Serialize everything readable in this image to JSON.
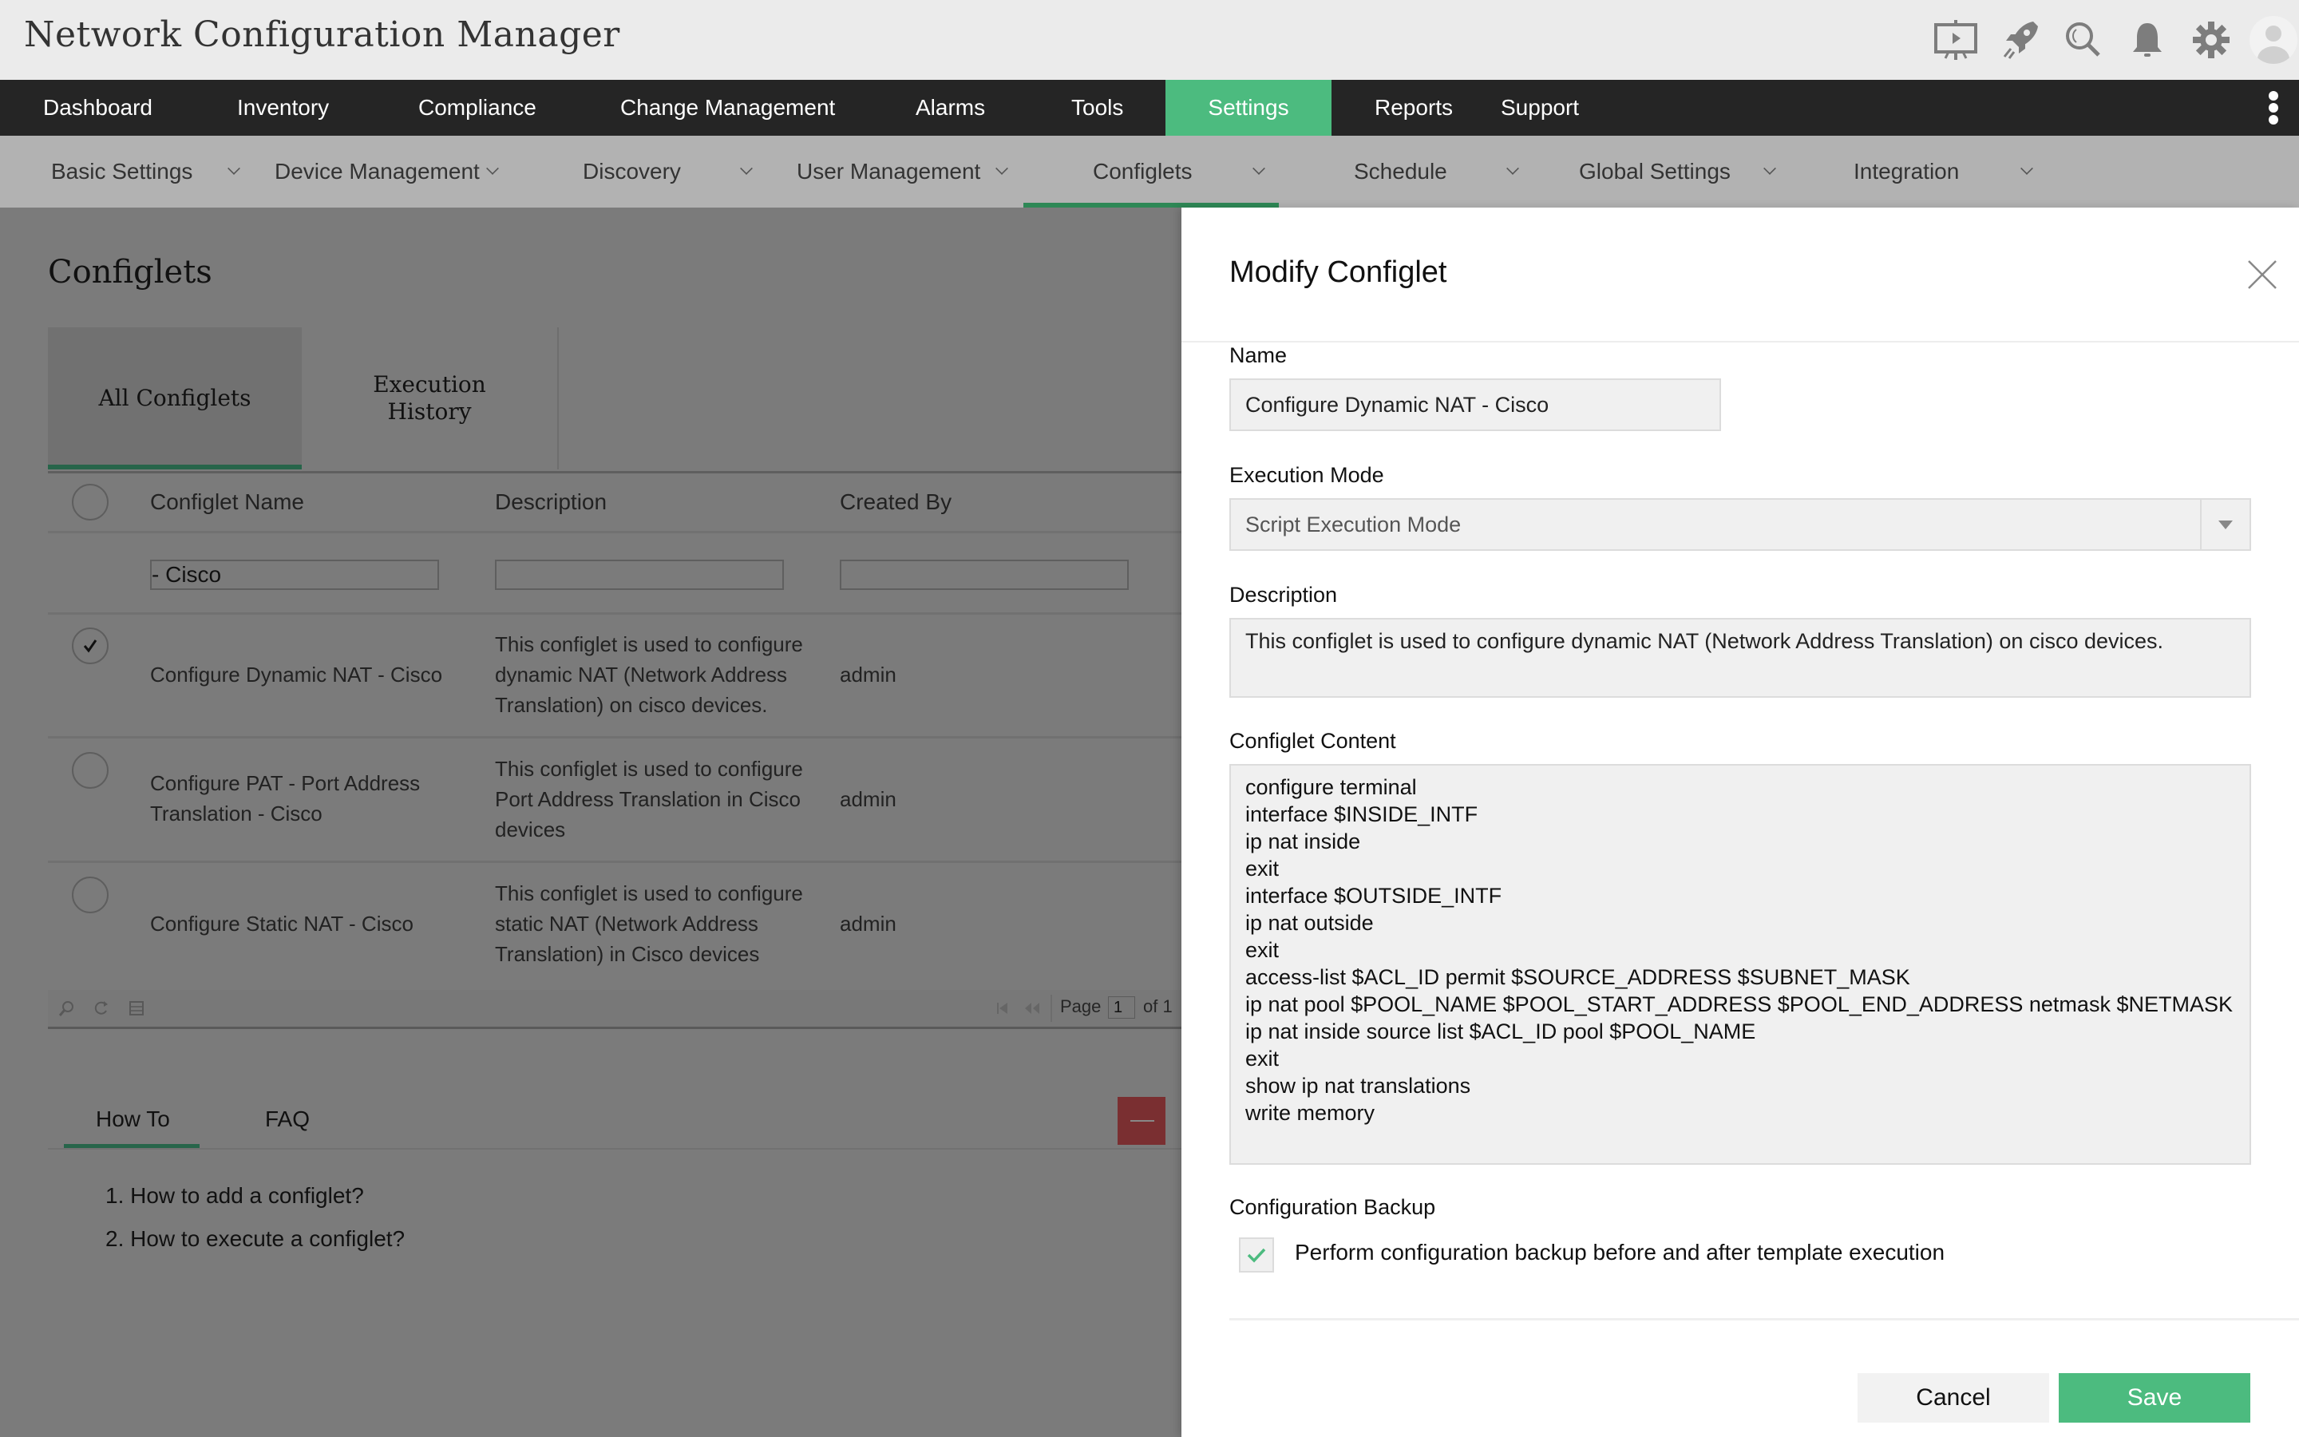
{
  "app": {
    "title": "Network Configuration Manager",
    "header_icons": [
      "presentation-icon",
      "rocket-icon",
      "search-icon",
      "bell-icon",
      "gear-icon",
      "user-avatar"
    ]
  },
  "main_nav": {
    "items": [
      {
        "label": "Dashboard"
      },
      {
        "label": "Inventory"
      },
      {
        "label": "Compliance"
      },
      {
        "label": "Change Management"
      },
      {
        "label": "Alarms"
      },
      {
        "label": "Tools"
      },
      {
        "label": "Settings",
        "active": true
      },
      {
        "label": "Reports"
      },
      {
        "label": "Support"
      }
    ],
    "active_color": "#4cbb7f"
  },
  "sub_nav": {
    "items": [
      {
        "label": "Basic Settings"
      },
      {
        "label": "Device Management"
      },
      {
        "label": "Discovery"
      },
      {
        "label": "User Management"
      },
      {
        "label": "Configlets",
        "active": true
      },
      {
        "label": "Schedule"
      },
      {
        "label": "Global Settings"
      },
      {
        "label": "Integration"
      }
    ]
  },
  "page": {
    "title": "Configlets",
    "tabs": [
      {
        "label": "All Configlets",
        "active": true
      },
      {
        "label": "Execution History"
      }
    ],
    "table": {
      "columns": [
        "Configlet Name",
        "Description",
        "Created By"
      ],
      "filters": {
        "name": "- Cisco",
        "description": "",
        "created_by": ""
      },
      "rows": [
        {
          "selected": true,
          "name": "Configure Dynamic NAT - Cisco",
          "description": "This configlet is used to configure dynamic NAT (Network Address Translation) on cisco devices.",
          "created_by": "admin"
        },
        {
          "selected": false,
          "name": "Configure PAT - Port Address Translation - Cisco",
          "description": "This configlet is used to configure Port Address Translation in Cisco devices",
          "created_by": "admin"
        },
        {
          "selected": false,
          "name": "Configure Static NAT - Cisco",
          "description": "This configlet is used to configure static NAT (Network Address Translation) in Cisco devices",
          "created_by": "admin"
        }
      ],
      "pager": {
        "page_label": "Page",
        "current_page": "1",
        "of_label": "of 1"
      }
    },
    "help": {
      "tabs": [
        {
          "label": "How To",
          "active": true
        },
        {
          "label": "FAQ"
        }
      ],
      "links": [
        "1. How to add a configlet?",
        "2. How to execute a configlet?"
      ]
    }
  },
  "panel": {
    "title": "Modify Configlet",
    "name_label": "Name",
    "name_value": "Configure Dynamic NAT - Cisco",
    "execution_mode_label": "Execution Mode",
    "execution_mode_value": "Script Execution Mode",
    "description_label": "Description",
    "description_value": "This configlet is used to configure dynamic NAT (Network Address Translation) on cisco devices.",
    "content_label": "Configlet Content",
    "content_lines": [
      "configure terminal",
      "interface $INSIDE_INTF",
      "ip nat inside",
      "exit",
      "interface $OUTSIDE_INTF",
      "ip nat outside",
      "exit",
      "access-list $ACL_ID permit $SOURCE_ADDRESS $SUBNET_MASK",
      "ip nat pool $POOL_NAME $POOL_START_ADDRESS $POOL_END_ADDRESS netmask $NETMASK",
      "ip nat inside source list $ACL_ID pool $POOL_NAME",
      "exit",
      "show ip nat translations",
      "write memory"
    ],
    "backup_label": "Configuration Backup",
    "backup_checked": true,
    "backup_option": "Perform configuration backup before and after template execution",
    "cancel_label": "Cancel",
    "save_label": "Save",
    "save_color": "#4cbb7f"
  }
}
